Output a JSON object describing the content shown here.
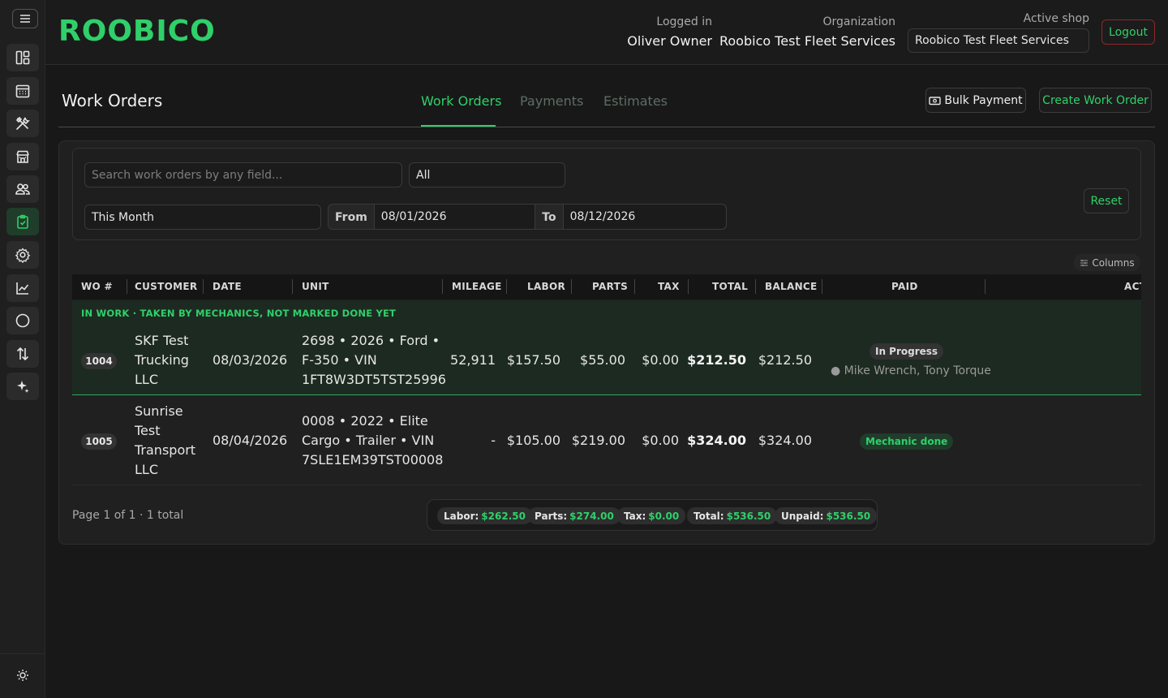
{
  "app": {
    "logo": "ROOBICO",
    "accent_color": "#2fd06a"
  },
  "header": {
    "logged_in_label": "Logged in",
    "user_name": "Oliver Owner",
    "organization_label": "Organization",
    "organization_name": "Roobico Test Fleet Services",
    "active_shop_label": "Active shop",
    "active_shop_value": "Roobico Test Fleet Services",
    "logout_label": "Logout"
  },
  "sidebar": {
    "items": [
      {
        "icon": "dashboard-icon"
      },
      {
        "icon": "calendar-icon"
      },
      {
        "icon": "tools-icon"
      },
      {
        "icon": "shop-icon"
      },
      {
        "icon": "customers-icon"
      },
      {
        "icon": "clipboard-icon",
        "active": true
      },
      {
        "icon": "gear-icon"
      },
      {
        "icon": "chart-icon"
      },
      {
        "icon": "circle-icon"
      },
      {
        "icon": "transfer-icon"
      },
      {
        "icon": "sparkle-icon"
      }
    ]
  },
  "page": {
    "title": "Work Orders",
    "tabs": [
      {
        "label": "Work Orders",
        "active": true
      },
      {
        "label": "Payments"
      },
      {
        "label": "Estimates"
      }
    ],
    "bulk_payment_label": "Bulk Payment",
    "create_label": "Create Work Order"
  },
  "filters": {
    "search_placeholder": "Search work orders by any field...",
    "status_value": "All",
    "period_value": "This Month",
    "from_label": "From",
    "from_value": "08/01/2026",
    "to_label": "To",
    "to_value": "08/12/2026",
    "reset_label": "Reset",
    "columns_label": "Columns"
  },
  "table": {
    "headers": [
      "WO #",
      "CUSTOMER",
      "DATE",
      "UNIT",
      "MILEAGE",
      "LABOR",
      "PARTS",
      "TAX",
      "TOTAL",
      "BALANCE",
      "PAID",
      "ACT"
    ],
    "group_label": "IN WORK · TAKEN BY MECHANICS, NOT MARKED DONE YET",
    "rows": [
      {
        "wo": "1004",
        "customer": [
          "SKF Test",
          "Trucking",
          "LLC"
        ],
        "date": "08/03/2026",
        "unit": [
          "2698 • 2026 • Ford •",
          "F-350 • VIN",
          "1FT8W3DT5TST25996"
        ],
        "mileage": "52,911",
        "labor": "$157.50",
        "parts": "$55.00",
        "tax": "$0.00",
        "total": "$212.50",
        "balance": "$212.50",
        "status": "In Progress",
        "mechanics": "● Mike Wrench, Tony Torque"
      },
      {
        "wo": "1005",
        "customer": [
          "Sunrise",
          "Test",
          "Transport",
          "LLC"
        ],
        "date": "08/04/2026",
        "unit": [
          "0008 • 2022 • Elite",
          "Cargo • Trailer • VIN",
          "7SLE1EM39TST00008"
        ],
        "mileage": "-",
        "labor": "$105.00",
        "parts": "$219.00",
        "tax": "$0.00",
        "total": "$324.00",
        "balance": "$324.00",
        "status": "Mechanic done"
      }
    ]
  },
  "footer": {
    "page_info": "Page 1 of 1 · 1 total",
    "totals": [
      {
        "label": "Labor:",
        "value": "$262.50"
      },
      {
        "label": "Parts:",
        "value": "$274.00"
      },
      {
        "label": "Tax:",
        "value": "$0.00"
      },
      {
        "label": "Total:",
        "value": "$536.50"
      },
      {
        "label": "Unpaid:",
        "value": "$536.50"
      }
    ]
  }
}
